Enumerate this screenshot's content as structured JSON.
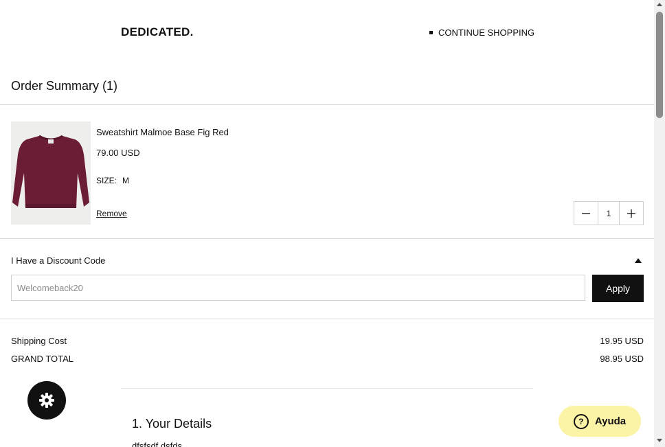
{
  "header": {
    "logo": "DEDICATED.",
    "continue_label": "CONTINUE SHOPPING"
  },
  "summary": {
    "title": "Order Summary (1)"
  },
  "product": {
    "name": "Sweatshirt Malmoe Base Fig Red",
    "price": "79.00 USD",
    "size_label": "SIZE:",
    "size_value": "M",
    "remove_label": "Remove",
    "quantity": "1",
    "image_icon": "sweatshirt-product-image",
    "image_color": "#6b1d36"
  },
  "discount": {
    "label": "I Have a Discount Code",
    "placeholder": "Welcomeback20",
    "apply_label": "Apply"
  },
  "totals": {
    "shipping_label": "Shipping Cost",
    "shipping_value": "19.95 USD",
    "grand_label": "GRAND TOTAL",
    "grand_value": "98.95 USD"
  },
  "details": {
    "title": "1. Your Details",
    "text": "dfsfsdf dsfds"
  },
  "floating": {
    "settings_icon": "gear-icon",
    "help_icon": "question-icon",
    "help_label": "Ayuda",
    "help_color": "#fbf3a6"
  }
}
